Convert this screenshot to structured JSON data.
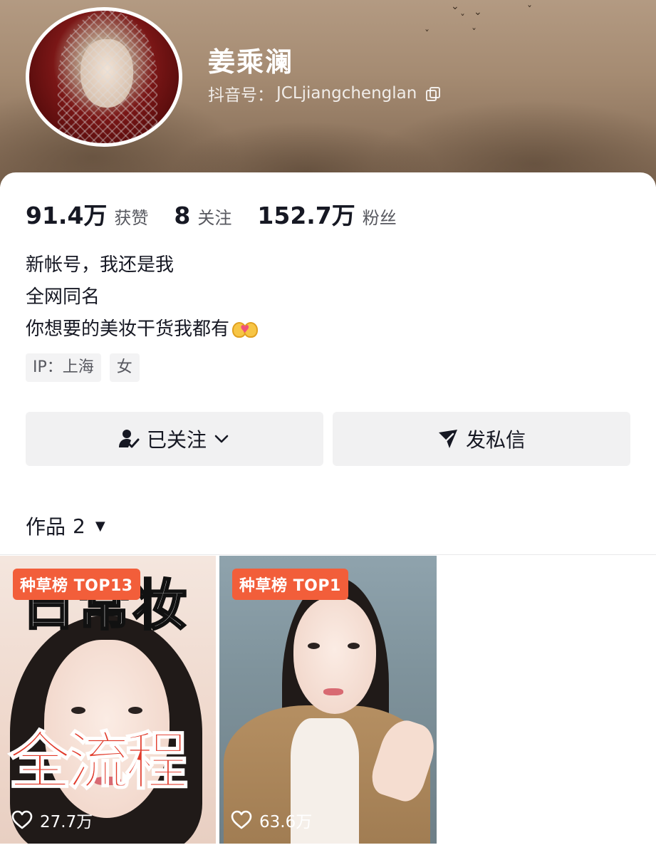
{
  "profile": {
    "name": "姜乘澜",
    "id_label": "抖音号：",
    "id_value": "JCLjiangchenglan"
  },
  "stats": [
    {
      "value": "91.4万",
      "label": "获赞"
    },
    {
      "value": "8",
      "label": "关注"
    },
    {
      "value": "152.7万",
      "label": "粉丝"
    }
  ],
  "bio": {
    "line1": "新帐号，我还是我",
    "line2": "全网同名",
    "line3": "你想要的美妆干货我都有",
    "emoji": "couple-with-heart-emoji"
  },
  "tags": {
    "ip": "IP：上海",
    "gender": "女"
  },
  "actions": {
    "follow_label": "已关注",
    "message_label": "发私信"
  },
  "works": {
    "label": "作品",
    "count": "2",
    "videos": [
      {
        "badge": "种草榜 TOP13",
        "overlay_top": "日常妆",
        "overlay_bottom": "全流程",
        "likes": "27.7万"
      },
      {
        "badge": "种草榜 TOP1",
        "likes": "63.6万"
      }
    ]
  },
  "colors": {
    "badge": "#f25e3a",
    "button_bg": "#f1f1f2",
    "text_primary": "#161823",
    "text_secondary": "#57585f"
  },
  "icons": [
    "copy-icon",
    "user-check-icon",
    "chevron-down-icon",
    "send-icon",
    "caret-down-icon",
    "heart-icon"
  ]
}
